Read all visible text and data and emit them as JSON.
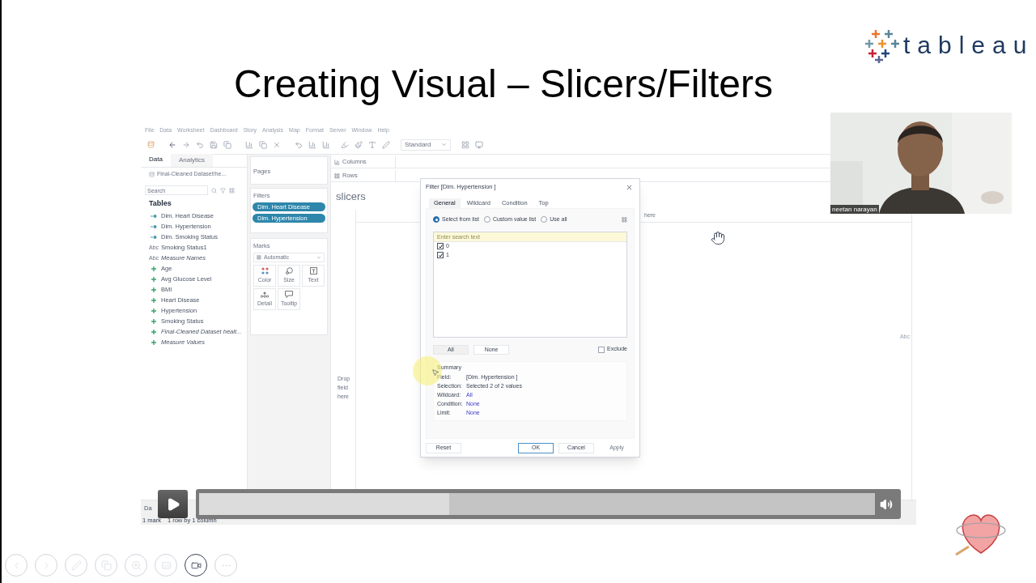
{
  "slide": {
    "title": "Creating Visual – Slicers/Filters",
    "logo_text": "tableau"
  },
  "tableau": {
    "menu": [
      "File",
      "Data",
      "Worksheet",
      "Dashboard",
      "Story",
      "Analysis",
      "Map",
      "Format",
      "Server",
      "Window",
      "Help"
    ],
    "view_dropdown": "Standard",
    "data_tabs": [
      {
        "label": "Data",
        "selected": true
      },
      {
        "label": "Analytics",
        "selected": false
      }
    ],
    "datasource": "Final-Cleaned Dataset!he...",
    "search_placeholder": "Search",
    "tables_heading": "Tables",
    "fields": [
      {
        "name": "Dim. Heart Disease",
        "kind": "dimension",
        "italic": false
      },
      {
        "name": "Dim. Hypertension",
        "kind": "dimension",
        "italic": false
      },
      {
        "name": "Dim. Smoking Status",
        "kind": "dimension",
        "italic": false
      },
      {
        "name": "Smoking Status1",
        "kind": "string",
        "badge": "Abc",
        "italic": false
      },
      {
        "name": "Measure Names",
        "kind": "string",
        "badge": "Abc",
        "italic": true
      },
      {
        "name": "Age",
        "kind": "measure",
        "italic": false
      },
      {
        "name": "Avg Glucose Level",
        "kind": "measure",
        "italic": false
      },
      {
        "name": "BMI",
        "kind": "measure",
        "italic": false
      },
      {
        "name": "Heart Disease",
        "kind": "measure",
        "italic": false
      },
      {
        "name": "Hypertension",
        "kind": "measure",
        "italic": false
      },
      {
        "name": "Smoking Status",
        "kind": "measure",
        "italic": false
      },
      {
        "name": "Final-Cleaned Dataset healt...",
        "kind": "measure",
        "italic": true
      },
      {
        "name": "Measure Values",
        "kind": "measure",
        "italic": true
      }
    ],
    "pages_label": "Pages",
    "filters_label": "Filters",
    "filters": [
      "Dim. Heart Disease",
      "Dim. Hypertension"
    ],
    "marks_label": "Marks",
    "mark_type": "Automatic",
    "mark_buttons": [
      {
        "label": "Color",
        "kind": "color"
      },
      {
        "label": "Size",
        "kind": "size"
      },
      {
        "label": "Text",
        "kind": "text"
      },
      {
        "label": "Detail",
        "kind": "detail"
      },
      {
        "label": "Tooltip",
        "kind": "tooltip"
      }
    ],
    "columns_label": "Columns",
    "rows_label": "Rows",
    "sheet_title": "slicers",
    "column_drop_text": "here",
    "row_drop_text": "Drop field here",
    "cell_text": "Abc",
    "sheet_tab": "Da",
    "status": [
      "1 mark",
      "1 row by 1 column"
    ]
  },
  "dialog": {
    "title": "Filter [Dim. Hypertension ]",
    "tabs": [
      {
        "label": "General",
        "selected": true
      },
      {
        "label": "Wildcard",
        "selected": false
      },
      {
        "label": "Condition",
        "selected": false
      },
      {
        "label": "Top",
        "selected": false
      }
    ],
    "modes": [
      {
        "label": "Select from list",
        "selected": true
      },
      {
        "label": "Custom value list",
        "selected": false
      },
      {
        "label": "Use all",
        "selected": false
      }
    ],
    "search_placeholder": "Enter search text",
    "values": [
      {
        "label": "0",
        "checked": true
      },
      {
        "label": "1",
        "checked": true
      }
    ],
    "all_button": "All",
    "none_button": "None",
    "exclude": {
      "label": "Exclude",
      "checked": false
    },
    "summary_label": "Summary",
    "summary": [
      {
        "label": "Field:",
        "value": "[Dim. Hypertension ]",
        "link": false
      },
      {
        "label": "Selection:",
        "value": "Selected 2 of 2 values",
        "link": false
      },
      {
        "label": "Wildcard:",
        "value": "All",
        "link": true
      },
      {
        "label": "Condition:",
        "value": "None",
        "link": true
      },
      {
        "label": "Limit:",
        "value": "None",
        "link": true
      }
    ],
    "buttons": [
      {
        "label": "Reset",
        "kind": "normal"
      },
      {
        "label": "OK",
        "kind": "default"
      },
      {
        "label": "Cancel",
        "kind": "normal"
      },
      {
        "label": "Apply",
        "kind": "disabled"
      }
    ]
  },
  "player": {
    "level": 0.37
  },
  "webcam": {
    "name": "neetan narayan"
  },
  "controls": [
    {
      "kind": "previous",
      "selected": false
    },
    {
      "kind": "next",
      "selected": false
    },
    {
      "kind": "pen",
      "selected": false
    },
    {
      "kind": "slides",
      "selected": false
    },
    {
      "kind": "zoom",
      "selected": false
    },
    {
      "kind": "subtitles",
      "selected": false
    },
    {
      "kind": "camera",
      "selected": true
    },
    {
      "kind": "more",
      "selected": false
    }
  ]
}
